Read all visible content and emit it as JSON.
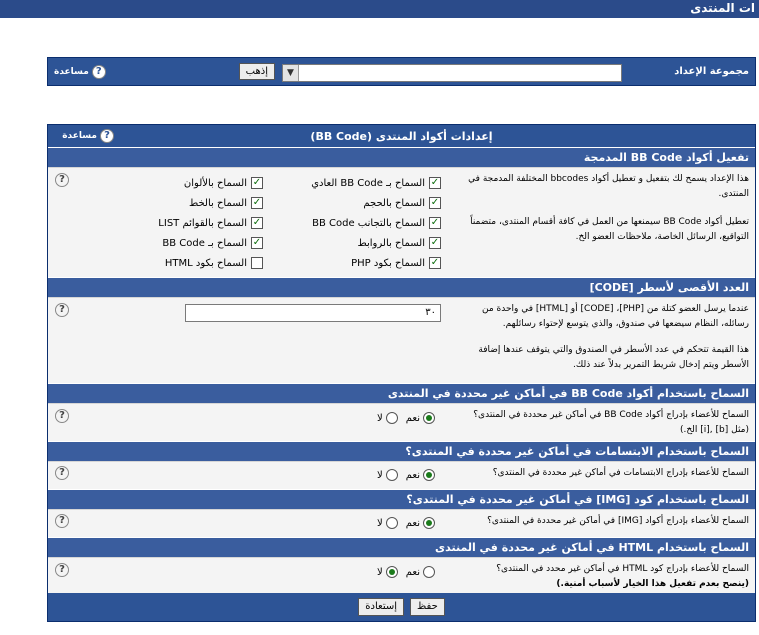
{
  "page_title": "ات المنتدى",
  "top_panel": {
    "label": "مجموعة الإعداد",
    "selected": "إعدادات أكواد المنتدى (BB Code)",
    "go_button": "إذهب",
    "help": "مساعدة"
  },
  "panel": {
    "title": "إعدادات أكواد المنتدى (BB Code)",
    "help": "مساعدة"
  },
  "section1": {
    "heading": "تفعيل أكواد BB Code المدمجة",
    "desc1": "هذا الإعداد يسمح لك بتفعيل و تعطيل أكواد bbcodes المختلفة المدمجة في المنتدى.",
    "desc2": "تعطيل أكواد BB Code سيمنعها من العمل في كافة أقسام المنتدى، متضمناً التواقيع، الرسائل الخاصة، ملاحظات العضو الخ.",
    "options": [
      {
        "label": "السماح بـ BB Code العادي",
        "checked": "✓"
      },
      {
        "label": "السماح بالألوان",
        "checked": "✓"
      },
      {
        "label": "السماح بالحجم",
        "checked": "✓"
      },
      {
        "label": "السماح بالخط",
        "checked": "✓"
      },
      {
        "label": "السماح بالتجانب BB Code",
        "checked": "✓"
      },
      {
        "label": "السماح بالقوائم LIST",
        "checked": "✓"
      },
      {
        "label": "السماح بالروابط",
        "checked": "✓"
      },
      {
        "label": "السماح بـ BB Code",
        "checked": "✓"
      },
      {
        "label": "السماح بكود PHP",
        "checked": "✓"
      },
      {
        "label": "السماح بكود HTML",
        "checked": ""
      }
    ]
  },
  "section2": {
    "heading": "العدد الأقصى لأسطر [CODE]",
    "desc1": "عندما يرسل العضو كتلة من [PHP]، [CODE] أو [HTML] في واحدة من رسائله، النظام سيضعها في صندوق، والذي يتوسع لإحتواء رسائلهم.",
    "desc2": "هذا القيمة تتحكم في عدد الأسطر في الصندوق والتي يتوقف عندها إضافة الأسطر ويتم إدخال شريط التمرير بدلاً عند ذلك.",
    "value": "٣٠"
  },
  "yes": "نعم",
  "no": "لا",
  "section3": {
    "heading": "السماح باستخدام أكواد BB Code في أماكن غير محددة في المنتدى",
    "desc": "السماح للأعضاء بإدراج أكواد BB Code في أماكن غير محددة في المنتدى؟ (مثل [b] ,[i] الخ.)"
  },
  "section4": {
    "heading": "السماح باستخدام الابتسامات في أماكن غير محددة في المنتدى؟",
    "desc": "السماح للأعضاء بإدراج الابتسامات في أماكن غير محددة في المنتدى؟"
  },
  "section5": {
    "heading": "السماح باستخدام كود [IMG] في أماكن غير محددة في المنتدى؟",
    "desc": "السماح للأعضاء بإدراج أكواد [IMG] في أماكن غير محددة في المنتدى؟"
  },
  "section6": {
    "heading": "السماح باستخدام HTML في أماكن غير محددة في المنتدى",
    "desc": "السماح للأعضاء بإدراج كود HTML في أماكن غير محدد في المنتدى؟",
    "warning": "(ينصح بعدم تفعيل هذا الخيار لأسباب أمنية.)"
  },
  "footer": {
    "save": "حفظ",
    "reset": "إستعادة"
  }
}
